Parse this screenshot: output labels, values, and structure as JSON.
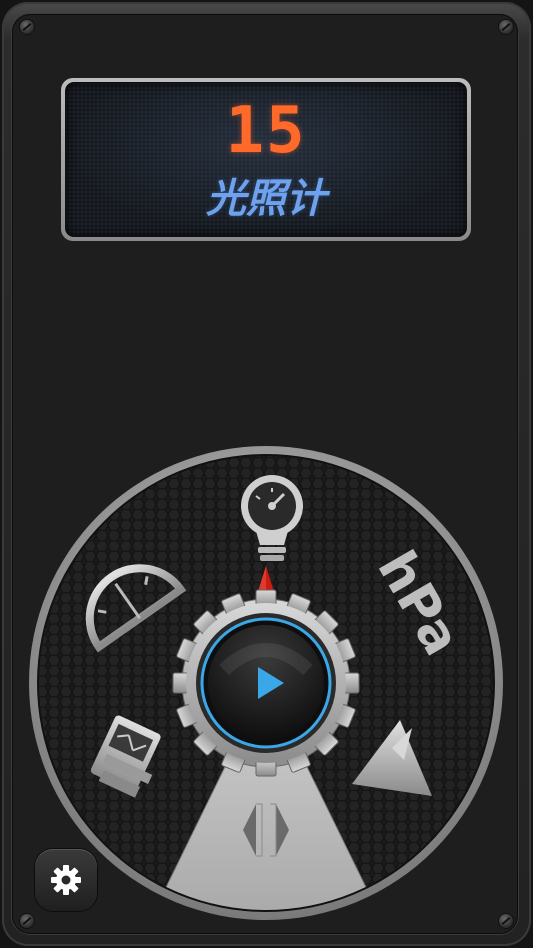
{
  "display": {
    "value": "15",
    "sensor_name": "光照计"
  },
  "dial": {
    "items": [
      {
        "name": "light-meter",
        "icon": "lightbulb-gauge-icon"
      },
      {
        "name": "pressure",
        "icon": "hpa-text-icon",
        "label": "hPa"
      },
      {
        "name": "altitude",
        "icon": "triangle-icon"
      },
      {
        "name": "seismometer",
        "icon": "seismograph-icon"
      },
      {
        "name": "protractor",
        "icon": "protractor-icon"
      }
    ],
    "play_icon": "play-icon",
    "slider_icon": "slider-arrows-icon"
  },
  "settings": {
    "icon": "gear-icon"
  },
  "colors": {
    "readout": "#ff6a2a",
    "sensor_name": "#6fa2ee",
    "ring_accent": "#3aa8e8",
    "pointer": "#cc1a10",
    "play": "#3aa8e8"
  }
}
